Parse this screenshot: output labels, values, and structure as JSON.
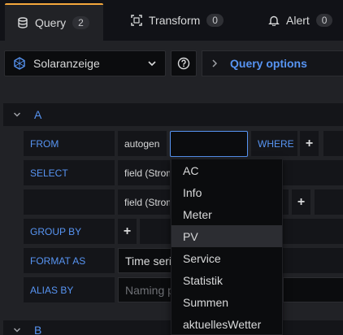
{
  "tabs": [
    {
      "label": "Query",
      "count": "2"
    },
    {
      "label": "Transform",
      "count": "0"
    },
    {
      "label": "Alert",
      "count": "0"
    }
  ],
  "datasource": {
    "name": "Solaranzeige"
  },
  "help": {
    "label": "?"
  },
  "query_options": {
    "label": "Query options"
  },
  "queries": [
    {
      "letter": "A"
    },
    {
      "letter": "B"
    }
  ],
  "rows": {
    "from_label": "FROM",
    "from_policy": "autogen",
    "from_measurement": "",
    "where_label": "WHERE",
    "select_label": "SELECT",
    "select_field_1": "field (Strom",
    "select_field_2": "field (Strom",
    "group_by_label": "GROUP BY",
    "format_as_label": "FORMAT AS",
    "format_as_value": "Time series",
    "alias_by_label": "ALIAS BY",
    "alias_by_placeholder": "Naming pattern",
    "plus": "+"
  },
  "dropdown": {
    "items": [
      "AC",
      "Info",
      "Meter",
      "PV",
      "Service",
      "Statistik",
      "Summen",
      "aktuellesWetter"
    ],
    "highlighted": "PV"
  },
  "colors": {
    "accent": "#5794f2",
    "tab_active": "#f5a83c"
  }
}
